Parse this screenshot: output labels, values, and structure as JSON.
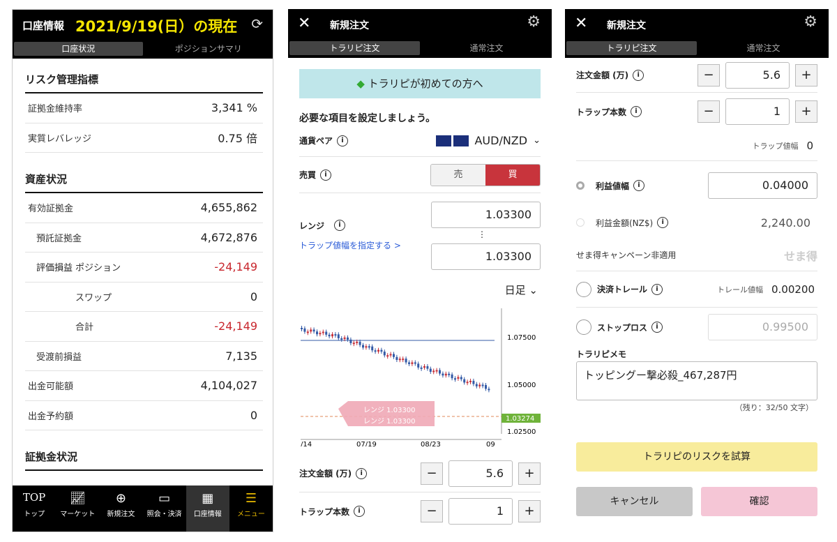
{
  "p1": {
    "title": "口座情報",
    "date": "2021/9/19(日）の現在",
    "tabs": [
      "口座状況",
      "ポジションサマリ"
    ],
    "risk_section": "リスク管理指標",
    "risk_rows": [
      {
        "label": "証拠金維持率",
        "value": "3,341 %"
      },
      {
        "label": "実質レバレッジ",
        "value": "0.75 倍"
      }
    ],
    "asset_section": "資産状況",
    "asset_rows": [
      {
        "label": "有効証拠金",
        "value": "4,655,862"
      },
      {
        "label": "預託証拠金",
        "value": "4,672,876"
      },
      {
        "label": "評価損益",
        "sub": "ポジション",
        "value": "-24,149"
      },
      {
        "label": "",
        "sub": "スワップ",
        "value": "0"
      },
      {
        "label": "",
        "sub": "合計",
        "value": "-24,149"
      },
      {
        "label": "受渡前損益",
        "value": "7,135"
      },
      {
        "label": "出金可能額",
        "value": "4,104,027"
      },
      {
        "label": "出金予約額",
        "value": "0"
      }
    ],
    "margin_section": "証拠金状況",
    "nav": [
      {
        "label": "トップ",
        "icon": "TOP"
      },
      {
        "label": "マーケット",
        "icon": "chart-icon"
      },
      {
        "label": "新規注文",
        "icon": "plus-icon"
      },
      {
        "label": "照会・決済",
        "icon": "card-icon"
      },
      {
        "label": "口座情報",
        "icon": "grid-icon"
      },
      {
        "label": "メニュー",
        "icon": "menu-icon"
      }
    ]
  },
  "p2": {
    "title": "新規注文",
    "tabs": [
      "トラリピ注文",
      "通常注文"
    ],
    "banner": "トラリピが初めての方へ",
    "prompt": "必要な項目を設定しましょう。",
    "pair_label": "通貨ペア",
    "pair_value": "AUD/NZD",
    "side_label": "売買",
    "sell": "売",
    "buy": "買",
    "range_label": "レンジ",
    "range_link": "トラップ値幅を指定する >",
    "range_high": "1.03300",
    "range_low": "1.03300",
    "timeframe": "日足",
    "chart_prices": [
      "1.07500",
      "1.05000",
      "1.03274",
      "1.02500"
    ],
    "chart_dates": [
      "/14",
      "07/19",
      "08/23",
      "09"
    ],
    "range_tag1": "レンジ 1.03300",
    "range_tag2": "レンジ 1.03300",
    "amount_label": "注文金額 (万)",
    "amount": "5.6",
    "trap_label": "トラップ本数",
    "trap": "1"
  },
  "p3": {
    "title": "新規注文",
    "tabs": [
      "トラリピ注文",
      "通常注文"
    ],
    "amount_label": "注文金額 (万)",
    "amount": "5.6",
    "trap_label": "トラップ本数",
    "trap": "1",
    "trap_width_label": "トラップ値幅",
    "trap_width": "0",
    "profit_width_label": "利益値幅",
    "profit_width": "0.04000",
    "profit_amount_label": "利益金額(NZ$)",
    "profit_amount": "2,240.00",
    "campaign": "せま得キャンペーン非適用",
    "campaign_badge": "せま得",
    "trail_label": "決済トレール",
    "trail_width_label": "トレール値幅",
    "trail_width": "0.00200",
    "stop_label": "ストップロス",
    "stop_value": "0.99500",
    "memo_label": "トラリピメモ",
    "memo": "トッピングー撃必殺_467,287円",
    "memo_count": "（残り：32/50 文字）",
    "risk_button": "トラリピのリスクを試算",
    "cancel": "キャンセル",
    "confirm": "確認"
  }
}
